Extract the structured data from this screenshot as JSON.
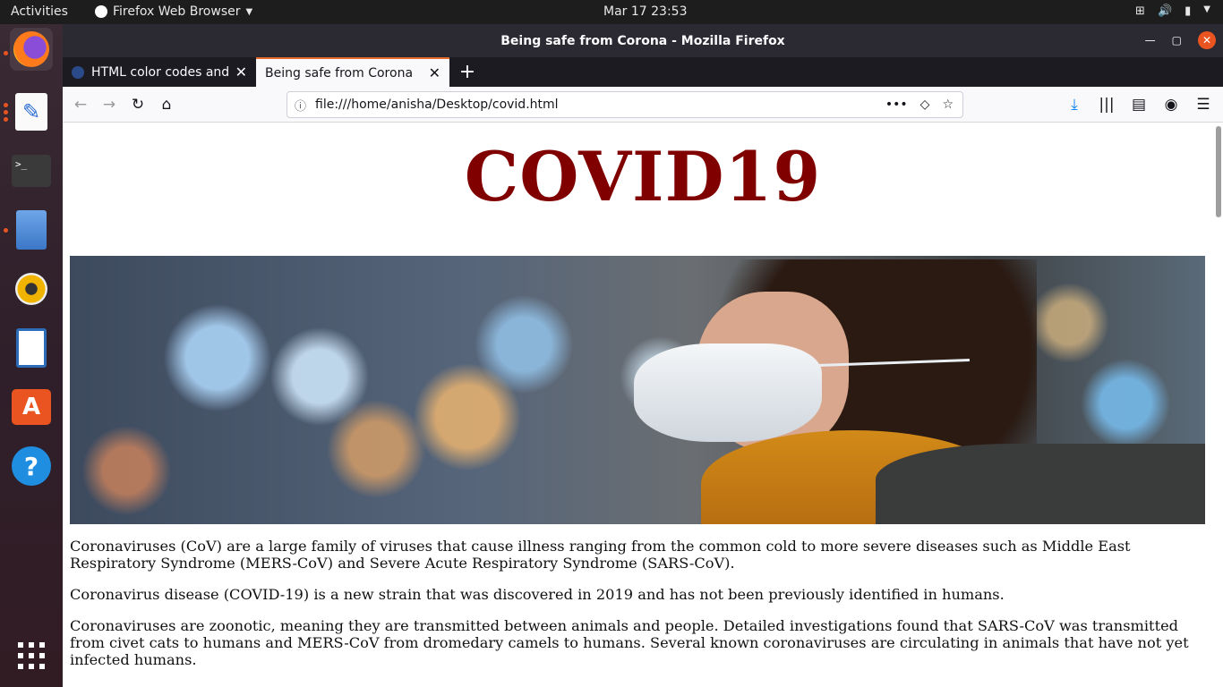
{
  "topbar": {
    "activities": "Activities",
    "app_name": "Firefox Web Browser",
    "clock": "Mar 17  23:53"
  },
  "window": {
    "title": "Being safe from Corona - Mozilla Firefox"
  },
  "tabs": [
    {
      "label": "HTML color codes and na",
      "active": false
    },
    {
      "label": "Being safe from Corona",
      "active": true
    }
  ],
  "urlbar": {
    "url": "file:///home/anisha/Desktop/covid.html"
  },
  "dock": {
    "items": [
      "firefox-icon",
      "text-editor-icon",
      "terminal-icon",
      "files-icon",
      "rhythmbox-icon",
      "writer-icon",
      "software-icon",
      "help-icon",
      "app-grid-icon"
    ]
  },
  "page": {
    "heading": "COVID19",
    "heading_color": "#800000",
    "paragraphs": [
      "Coronaviruses (CoV) are a large family of viruses that cause illness ranging from the common cold to more severe diseases such as Middle East Respiratory Syndrome (MERS-CoV) and Severe Acute Respiratory Syndrome (SARS-CoV).",
      "Coronavirus disease (COVID-19) is a new strain that was discovered in 2019 and has not been previously identified in humans.",
      "Coronaviruses are zoonotic, meaning they are transmitted between animals and people. Detailed investigations found that SARS-CoV was transmitted from civet cats to humans and MERS-CoV from dromedary camels to humans. Several known coronaviruses are circulating in animals that have not yet infected humans."
    ]
  }
}
